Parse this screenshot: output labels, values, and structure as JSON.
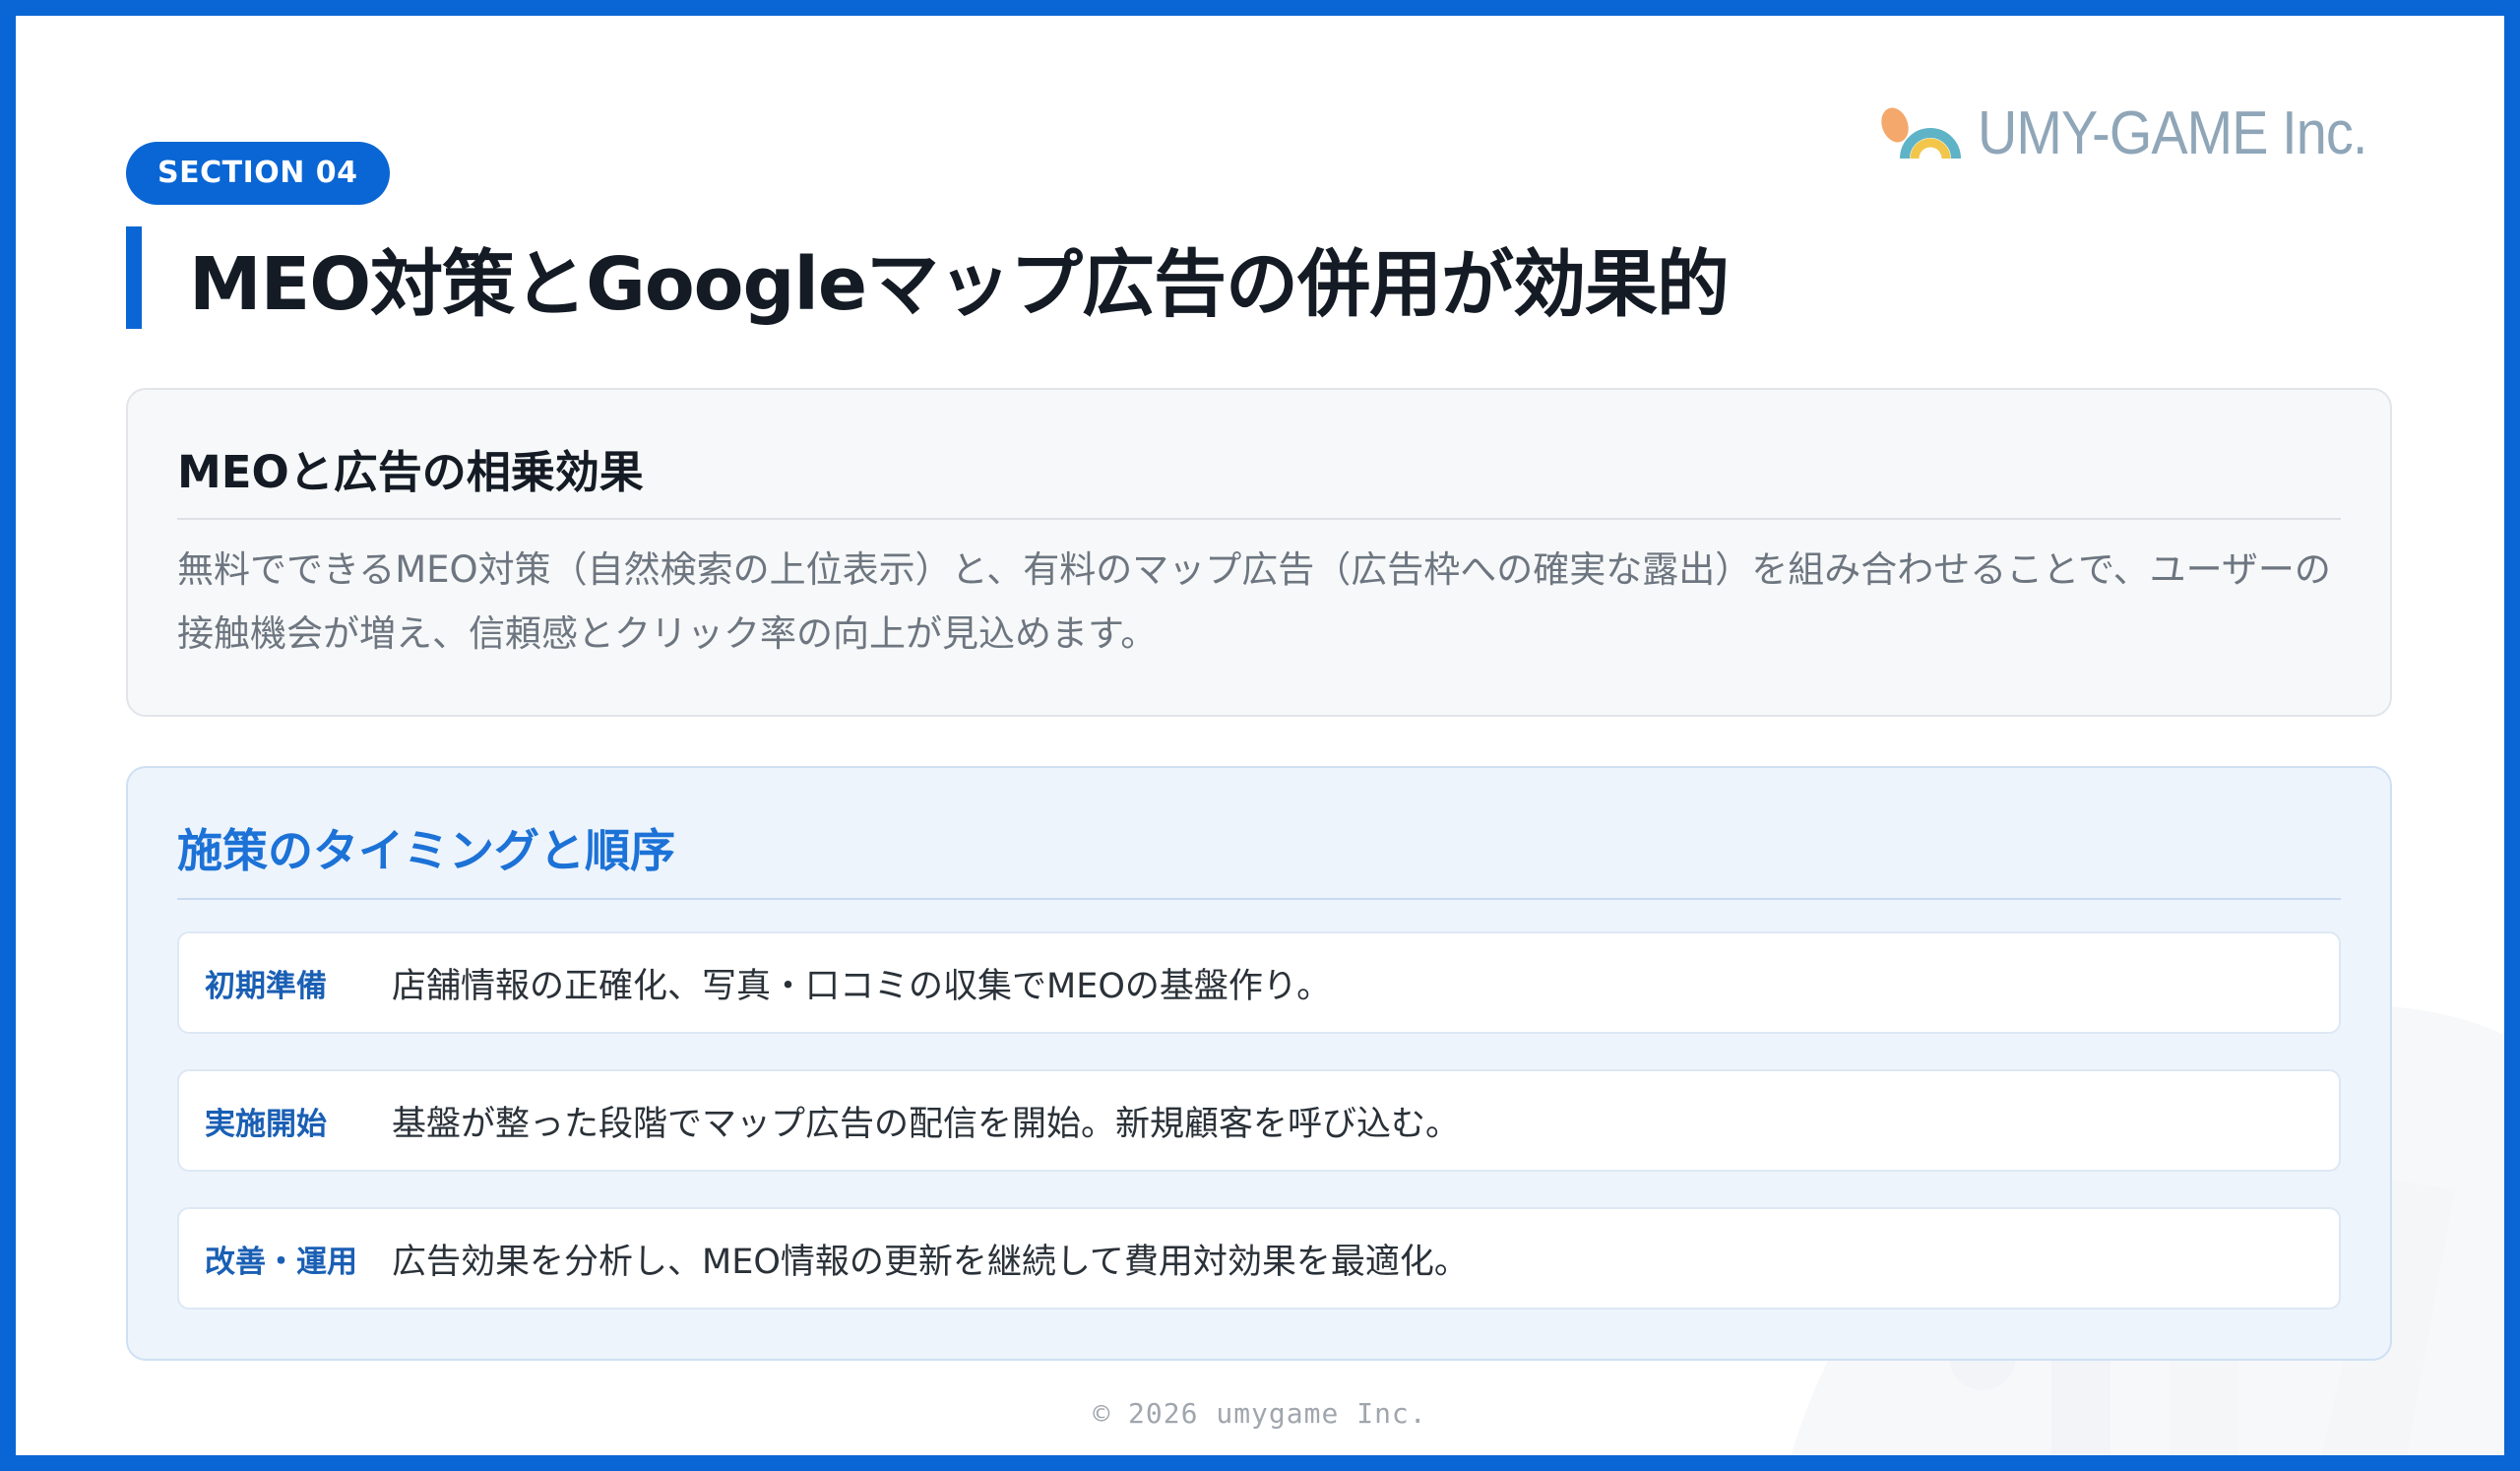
{
  "brand": {
    "logo_text": "UMY-GAME Inc.",
    "accent_color": "#0a66d4"
  },
  "header": {
    "section_badge": "SECTION 04",
    "title": "MEO対策とGoogleマップ広告の併用が効果的"
  },
  "synergy_card": {
    "title": "MEOと広告の相乗効果",
    "body": "無料でできるMEO対策（自然検索の上位表示）と、有料のマップ広告（広告枠への確実な露出）を組み合わせることで、ユーザーの接触機会が増え、信頼感とクリック率の向上が見込めます。"
  },
  "timing_card": {
    "title": "施策のタイミングと順序",
    "steps": [
      {
        "label": "初期準備",
        "text": "店舗情報の正確化、写真・口コミの収集でMEOの基盤作り。"
      },
      {
        "label": "実施開始",
        "text": "基盤が整った段階でマップ広告の配信を開始。新規顧客を呼び込む。"
      },
      {
        "label": "改善・運用",
        "text": "広告効果を分析し、MEO情報の更新を継続して費用対効果を最適化。"
      }
    ]
  },
  "footer": {
    "copyright": "© 2026 umygame Inc."
  }
}
